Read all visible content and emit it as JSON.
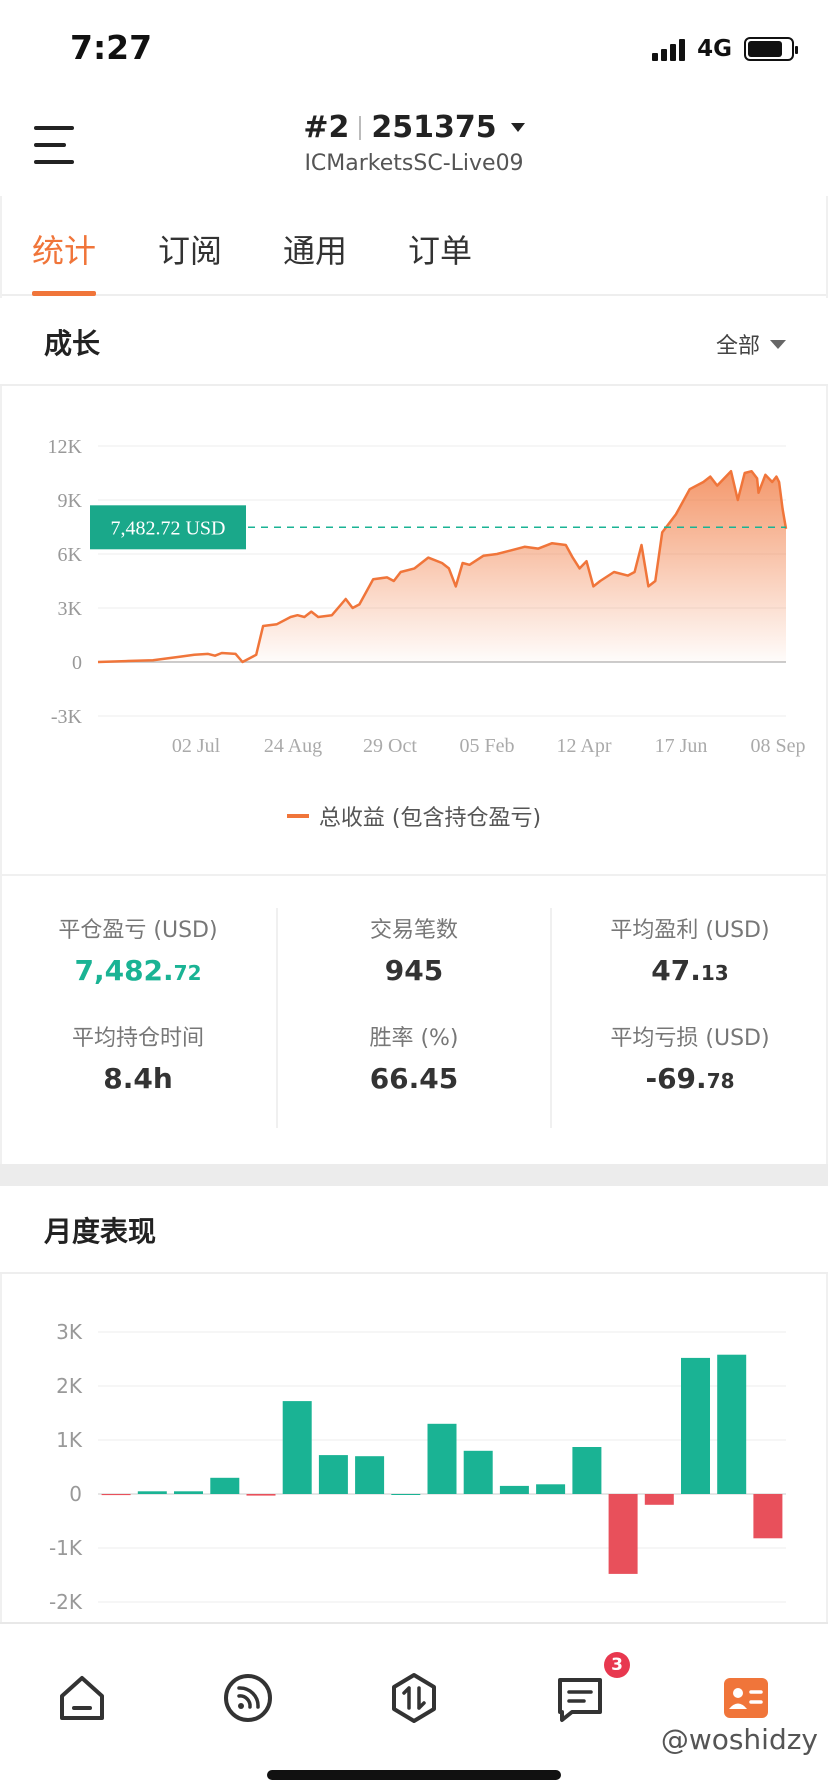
{
  "status_bar": {
    "time": "7:27",
    "network": "4G"
  },
  "header": {
    "account_num": "#2",
    "account_id": "251375",
    "server": "ICMarketsSC-Live09"
  },
  "tabs": [
    {
      "label": "统计",
      "active": true
    },
    {
      "label": "订阅",
      "active": false
    },
    {
      "label": "通用",
      "active": false
    },
    {
      "label": "订单",
      "active": false
    }
  ],
  "growth": {
    "title": "成长",
    "filter": "全部",
    "legend": "总收益 (包含持仓盈亏)"
  },
  "stats": {
    "closed_pnl": {
      "label": "平仓盈亏 (USD)",
      "int": "7,482.",
      "dec": "72"
    },
    "trades": {
      "label": "交易笔数",
      "int": "945",
      "dec": ""
    },
    "avg_profit": {
      "label": "平均盈利 (USD)",
      "int": "47.",
      "dec": "13"
    },
    "avg_hold": {
      "label": "平均持仓时间",
      "int": "8.4h",
      "dec": ""
    },
    "win_rate": {
      "label": "胜率 (%)",
      "int": "66.45",
      "dec": ""
    },
    "avg_loss": {
      "label": "平均亏损 (USD)",
      "int": "-69.",
      "dec": "78"
    }
  },
  "monthly": {
    "title": "月度表现"
  },
  "bottom_nav": {
    "badge": "3"
  },
  "watermark": "@woshidzy",
  "colors": {
    "accent": "#f0753a",
    "green": "#1ab394",
    "red": "#e8505b"
  },
  "chart_data": [
    {
      "type": "area",
      "yticks": [
        "12K",
        "9K",
        "6K",
        "3K",
        "0",
        "-3K"
      ],
      "ylim": [
        -3000,
        12000
      ],
      "xticks": [
        "02 Jul",
        "24 Aug",
        "29 Oct",
        "05 Feb",
        "12 Apr",
        "17 Jun",
        "08 Sep"
      ],
      "series": [
        {
          "name": "总收益 (包含持仓盈亏)",
          "x": [
            0,
            4,
            8,
            12,
            14,
            16,
            17,
            18,
            20,
            21,
            23,
            24,
            26,
            28,
            29,
            30,
            31,
            32,
            34,
            36,
            37,
            38,
            40,
            42,
            43,
            44,
            46,
            48,
            50,
            51,
            52,
            53,
            54,
            56,
            58,
            60,
            62,
            64,
            66,
            68,
            69,
            70,
            71,
            72,
            73,
            75,
            77,
            78,
            79,
            80,
            81,
            82,
            84,
            86,
            88,
            89,
            90,
            92,
            93,
            94,
            95,
            95.8,
            96,
            97,
            98,
            98.6,
            99,
            99.5,
            100
          ],
          "values": [
            0,
            50,
            100,
            300,
            400,
            450,
            350,
            500,
            450,
            0,
            400,
            2000,
            2100,
            2500,
            2600,
            2500,
            2800,
            2500,
            2600,
            3500,
            3000,
            3200,
            4600,
            4700,
            4500,
            5000,
            5200,
            5800,
            5500,
            5200,
            4200,
            5500,
            5400,
            5900,
            6000,
            6200,
            6400,
            6300,
            6600,
            6500,
            5800,
            5200,
            5600,
            4200,
            4500,
            5000,
            4800,
            5000,
            6500,
            4200,
            4500,
            7200,
            8200,
            9600,
            10000,
            10300,
            9800,
            10600,
            9000,
            10500,
            10600,
            10200,
            9400,
            10400,
            10000,
            10300,
            10000,
            8500,
            7400
          ]
        },
        {
          "name": "平仓盈亏",
          "values": [
            7482.72
          ],
          "label": "7,482.72 USD"
        }
      ]
    },
    {
      "type": "bar",
      "yticks": [
        "3K",
        "2K",
        "1K",
        "0",
        "-1K",
        "-2K"
      ],
      "ylim": [
        -2000,
        3000
      ],
      "values": [
        -20,
        50,
        50,
        300,
        -30,
        1720,
        720,
        700,
        0,
        1300,
        800,
        150,
        180,
        870,
        -1480,
        -200,
        2520,
        2580,
        -820
      ]
    }
  ]
}
